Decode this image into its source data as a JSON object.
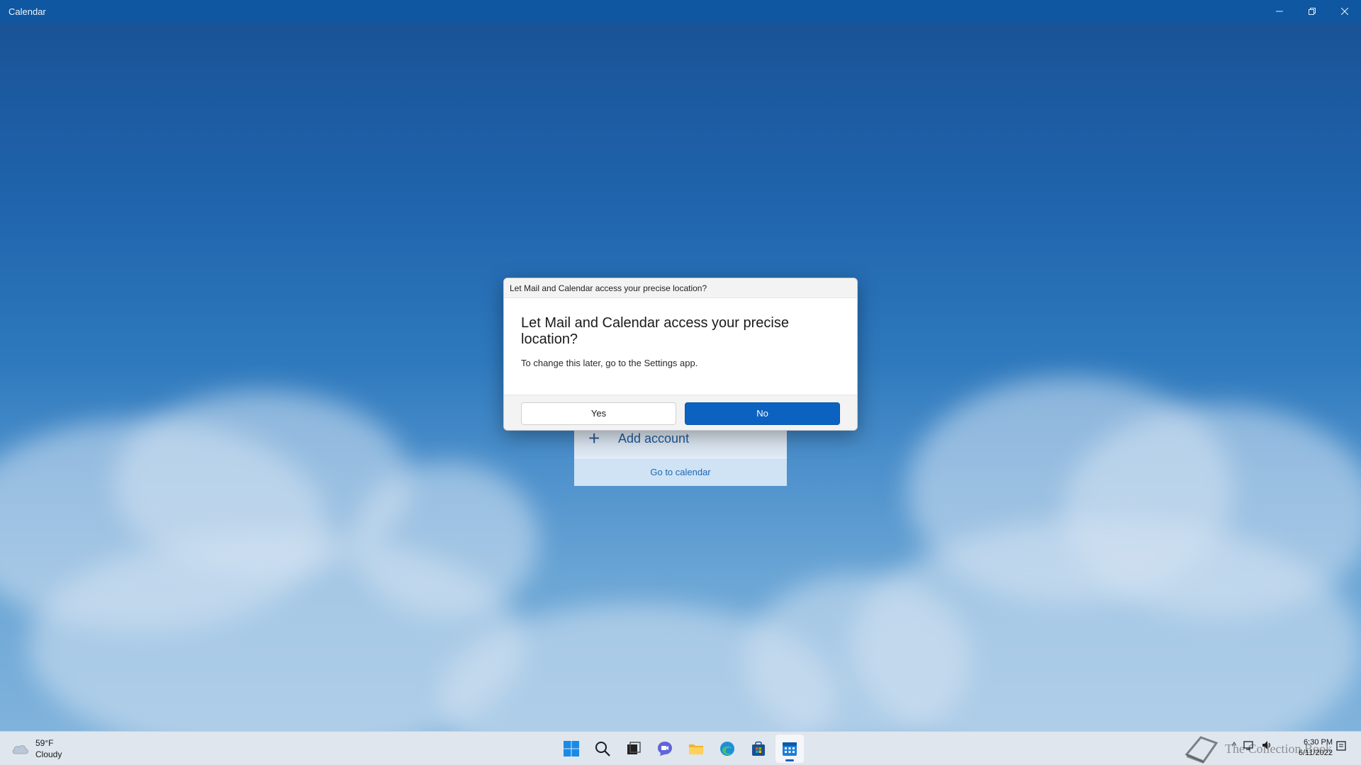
{
  "window": {
    "title": "Calendar"
  },
  "welcome": {
    "add_account_label": "Add account",
    "go_to_calendar_label": "Go to calendar"
  },
  "dialog": {
    "window_title": "Let Mail and Calendar access your precise location?",
    "heading": "Let Mail and Calendar access your precise location?",
    "subtext": "To change this later, go to the Settings app.",
    "yes_label": "Yes",
    "no_label": "No",
    "accent_color": "#0b62c0"
  },
  "taskbar": {
    "weather": {
      "temperature": "59°F",
      "condition": "Cloudy"
    },
    "apps": [
      {
        "icon": "windows-start-icon"
      },
      {
        "icon": "search-icon"
      },
      {
        "icon": "task-view-icon"
      },
      {
        "icon": "chat-icon"
      },
      {
        "icon": "file-explorer-icon"
      },
      {
        "icon": "edge-browser-icon"
      },
      {
        "icon": "microsoft-store-icon"
      },
      {
        "icon": "calendar-app-icon",
        "active": true
      }
    ],
    "watermark": "The Collection Book",
    "clock": {
      "time": "6:30 PM",
      "date": "6/11/2022"
    }
  }
}
